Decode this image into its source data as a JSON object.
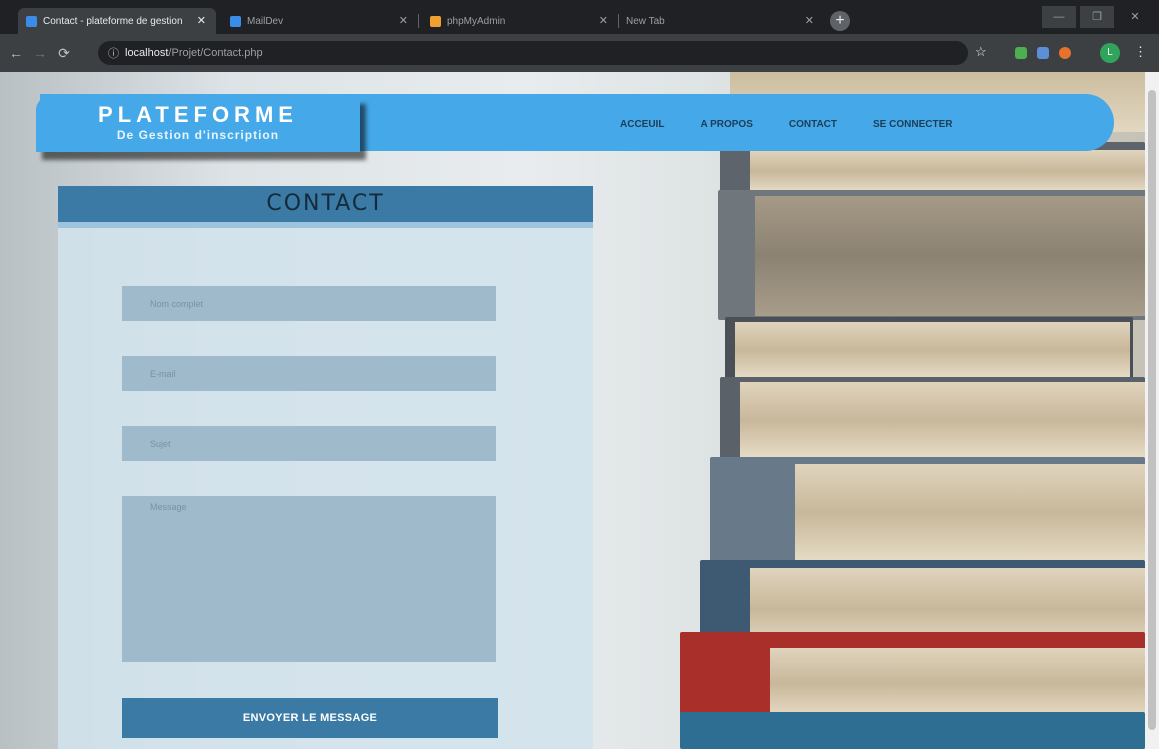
{
  "browser": {
    "tabs": [
      {
        "label": "Contact - plateforme de gestion",
        "active": true,
        "favicon_color": "#3b8be8"
      },
      {
        "label": "MailDev",
        "active": false,
        "favicon_color": "#3b8be8"
      },
      {
        "label": "phpMyAdmin",
        "active": false,
        "favicon_color": "#f0a030"
      },
      {
        "label": "New Tab",
        "active": false,
        "favicon_color": ""
      }
    ],
    "url_host": "localhost",
    "url_path": "/Projet/Contact.php",
    "profile_initial": "L"
  },
  "site": {
    "brand_title": "PLATEFORME",
    "brand_subtitle": "De Gestion d'inscription",
    "nav": [
      "ACCEUIL",
      "A PROPOS",
      "CONTACT",
      "SE CONNECTER"
    ],
    "accent_color": "#45a8e8",
    "header_color": "#3a7aa4"
  },
  "contact": {
    "title": "CONTACT",
    "fields": {
      "name_placeholder": "Nom complet",
      "email_placeholder": "E-mail",
      "subject_placeholder": "Sujet",
      "message_placeholder": "Message"
    },
    "submit_label": "ENVOYER LE MESSAGE"
  }
}
